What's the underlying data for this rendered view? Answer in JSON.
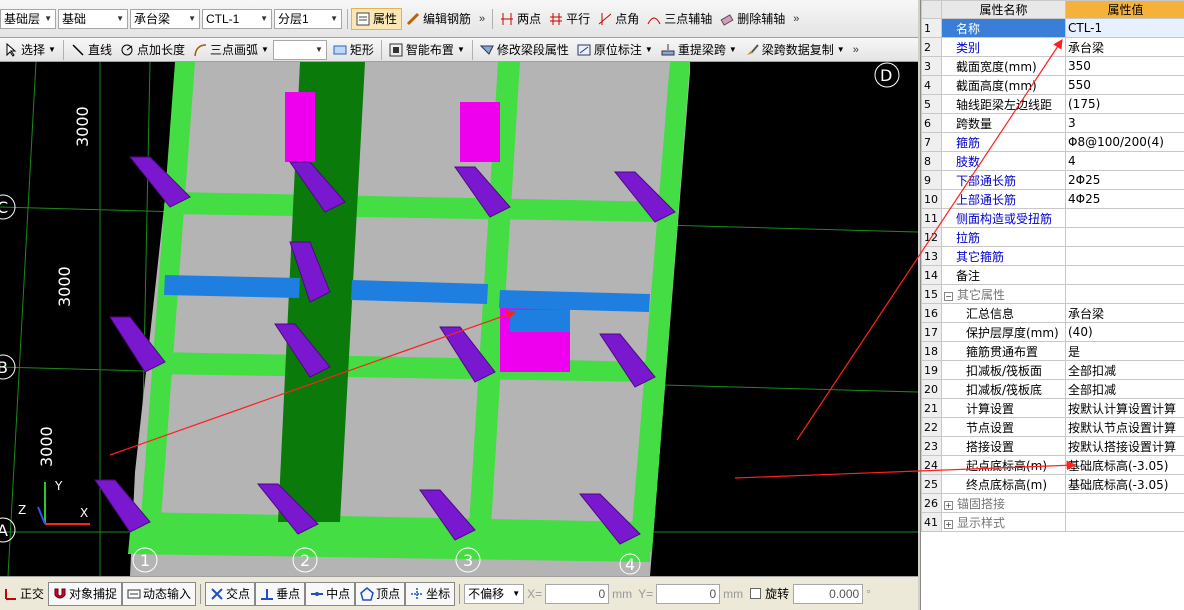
{
  "toolbar1": {
    "floor": "基础层",
    "category": "基础",
    "member_type": "承台梁",
    "member": "CTL-1",
    "layer": "分层1",
    "props_btn": "属性",
    "edit_rebar": "编辑钢筋",
    "two_points": "两点",
    "parallel": "平行",
    "point_angle": "点角",
    "three_point_axis": "三点辅轴",
    "delete_axis": "删除辅轴"
  },
  "toolbar2": {
    "select": "选择",
    "line": "直线",
    "point_add_length": "点加长度",
    "three_point_arc": "三点画弧",
    "arc_combo": "",
    "rect": "矩形",
    "smart_layout": "智能布置",
    "modify_beam_span": "修改梁段属性",
    "original_label": "原位标注",
    "relift_span": "重提梁跨",
    "copy_span_data": "梁跨数据复制"
  },
  "viewport": {
    "axis_labels": {
      "d": "D",
      "c": "C",
      "b": "B",
      "a": "A",
      "n1": "1",
      "n2": "2",
      "n3": "3",
      "n4": "4"
    },
    "dims": [
      "3000",
      "3000",
      "3000"
    ],
    "coord": {
      "x": "X",
      "y": "Y",
      "z": "Z"
    }
  },
  "properties": {
    "header_name": "属性名称",
    "header_value": "属性值",
    "rows": [
      {
        "num": "1",
        "name": "名称",
        "value": "CTL-1",
        "style": "blue"
      },
      {
        "num": "2",
        "name": "类别",
        "value": "承台梁",
        "style": "blue"
      },
      {
        "num": "3",
        "name": "截面宽度(mm)",
        "value": "350",
        "style": ""
      },
      {
        "num": "4",
        "name": "截面高度(mm)",
        "value": "550",
        "style": ""
      },
      {
        "num": "5",
        "name": "轴线距梁左边线距",
        "value": "(175)",
        "style": ""
      },
      {
        "num": "6",
        "name": "跨数量",
        "value": "3",
        "style": ""
      },
      {
        "num": "7",
        "name": "箍筋",
        "value": "Φ8@100/200(4)",
        "style": "blue"
      },
      {
        "num": "8",
        "name": "肢数",
        "value": "4",
        "style": "blue"
      },
      {
        "num": "9",
        "name": "下部通长筋",
        "value": "2Φ25",
        "style": "blue"
      },
      {
        "num": "10",
        "name": "上部通长筋",
        "value": "4Φ25",
        "style": "blue"
      },
      {
        "num": "11",
        "name": "侧面构造或受扭筋",
        "value": "",
        "style": "blue"
      },
      {
        "num": "12",
        "name": "拉筋",
        "value": "",
        "style": "blue"
      },
      {
        "num": "13",
        "name": "其它箍筋",
        "value": "",
        "style": "blue"
      },
      {
        "num": "14",
        "name": "备注",
        "value": "",
        "style": ""
      },
      {
        "num": "15",
        "name": "其它属性",
        "value": "",
        "style": "grey",
        "group": "minus"
      },
      {
        "num": "16",
        "name": "汇总信息",
        "value": "承台梁",
        "style": "",
        "indent": true
      },
      {
        "num": "17",
        "name": "保护层厚度(mm)",
        "value": "(40)",
        "style": "",
        "indent": true
      },
      {
        "num": "18",
        "name": "箍筋贯通布置",
        "value": "是",
        "style": "",
        "indent": true
      },
      {
        "num": "19",
        "name": "扣减板/筏板面",
        "value": "全部扣减",
        "style": "",
        "indent": true
      },
      {
        "num": "20",
        "name": "扣减板/筏板底",
        "value": "全部扣减",
        "style": "",
        "indent": true
      },
      {
        "num": "21",
        "name": "计算设置",
        "value": "按默认计算设置计算",
        "style": "",
        "indent": true
      },
      {
        "num": "22",
        "name": "节点设置",
        "value": "按默认节点设置计算",
        "style": "",
        "indent": true
      },
      {
        "num": "23",
        "name": "搭接设置",
        "value": "按默认搭接设置计算",
        "style": "",
        "indent": true
      },
      {
        "num": "24",
        "name": "起点底标高(m)",
        "value": "基础底标高(-3.05)",
        "style": "",
        "indent": true
      },
      {
        "num": "25",
        "name": "终点底标高(m)",
        "value": "基础底标高(-3.05)",
        "style": "",
        "indent": true
      },
      {
        "num": "26",
        "name": "锚固搭接",
        "value": "",
        "style": "grey",
        "group": "plus"
      },
      {
        "num": "41",
        "name": "显示样式",
        "value": "",
        "style": "grey",
        "group": "plus"
      }
    ]
  },
  "statusbar": {
    "ortho": "正交",
    "snap": "对象捕捉",
    "dynamic_input": "动态输入",
    "intersection": "交点",
    "perpendicular": "垂点",
    "midpoint": "中点",
    "vertex": "顶点",
    "coordinate": "坐标",
    "offset_mode": "不偏移",
    "x_label": "X=",
    "x_value": "0",
    "y_label": "Y=",
    "y_value": "0",
    "unit": "mm",
    "rotate": "旋转",
    "rotate_value": "0.000",
    "degree": "°"
  },
  "colors": {
    "beam_green": "#44dd44",
    "dark_green": "#0a7a0a",
    "slab_grey": "#b4b4b4",
    "pier_purple": "#7a18d0",
    "magenta": "#ee00ee",
    "blue_bar": "#1f7fe0",
    "header_orange": "#f4b23a",
    "selected_blue": "#3a7ed8",
    "arrow_red": "#ff2020"
  }
}
